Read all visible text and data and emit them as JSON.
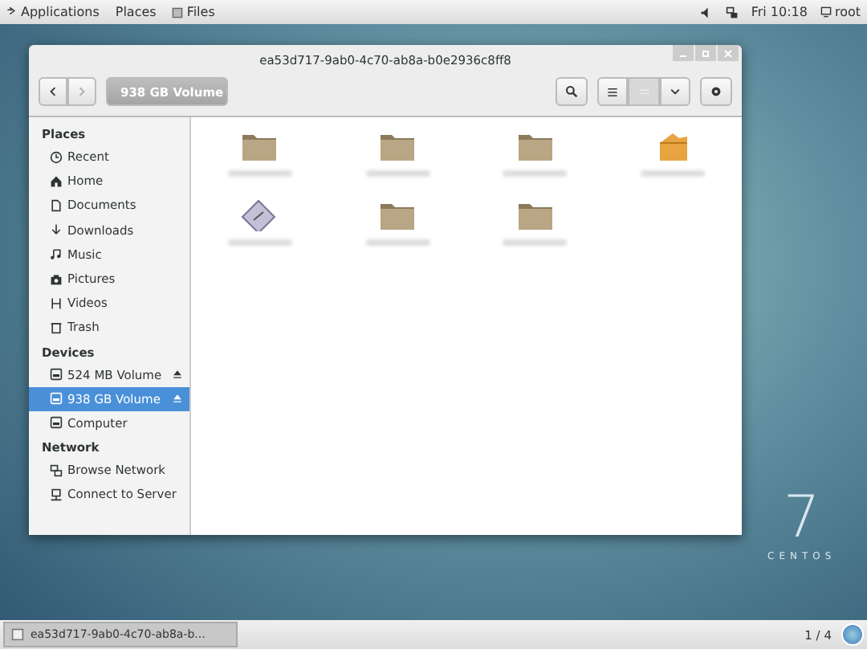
{
  "top_bar": {
    "menus": [
      "Applications",
      "Places"
    ],
    "app": "Files",
    "clock": "Fri 10:18",
    "user": "root"
  },
  "window": {
    "title": "ea53d717-9ab0-4c70-ab8a-b0e2936c8ff8",
    "path_button": "938 GB Volume",
    "sidebar": [
      {
        "heading": "Places",
        "items": [
          {
            "label": "Recent",
            "selected": false
          },
          {
            "label": "Home",
            "selected": false
          },
          {
            "label": "Documents",
            "selected": false
          },
          {
            "label": "Downloads",
            "selected": false
          },
          {
            "label": "Music",
            "selected": false
          },
          {
            "label": "Pictures",
            "selected": false
          },
          {
            "label": "Videos",
            "selected": false
          },
          {
            "label": "Trash",
            "selected": false
          }
        ]
      },
      {
        "heading": "Devices",
        "items": [
          {
            "label": "524 MB Volume",
            "selected": false,
            "eject": true
          },
          {
            "label": "938 GB Volume",
            "selected": true,
            "eject": true
          },
          {
            "label": "Computer",
            "selected": false,
            "eject": false
          }
        ]
      },
      {
        "heading": "Network",
        "items": [
          {
            "label": "Browse Network",
            "selected": false
          },
          {
            "label": "Connect to Server",
            "selected": false
          }
        ]
      }
    ],
    "files": [
      {
        "kind": "folder"
      },
      {
        "kind": "folder"
      },
      {
        "kind": "folder"
      },
      {
        "kind": "package"
      },
      {
        "kind": "script"
      },
      {
        "kind": "folder"
      },
      {
        "kind": "folder"
      }
    ]
  },
  "desktop": {
    "logo_number": "7",
    "logo_text": "CENTOS"
  },
  "taskbar": {
    "task": "ea53d717-9ab0-4c70-ab8a-b...",
    "workspace": "1 / 4"
  }
}
